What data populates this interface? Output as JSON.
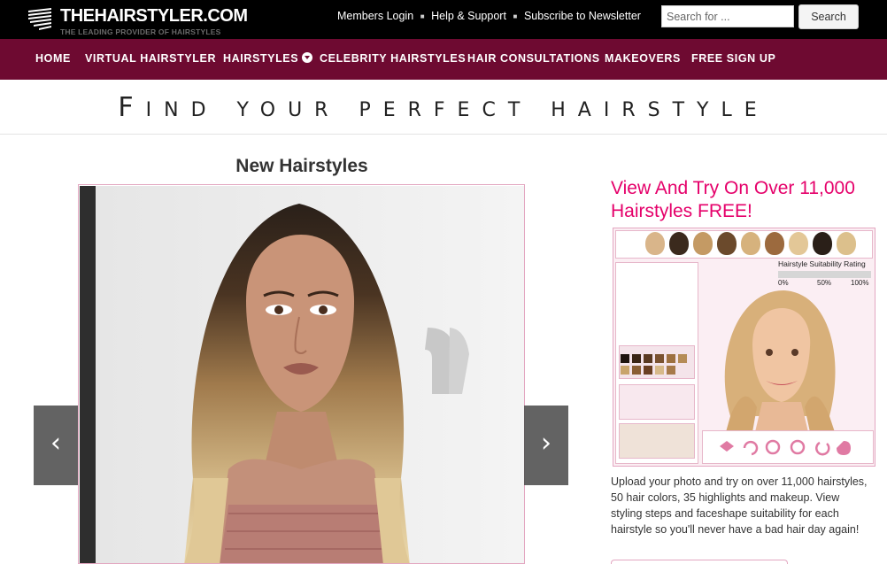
{
  "header": {
    "logo_title": "THEHAIRSTYLER.COM",
    "logo_tagline": "THE LEADING PROVIDER OF HAIRSTYLES",
    "top_links": [
      "Members Login",
      "Help & Support",
      "Subscribe to Newsletter"
    ],
    "search": {
      "placeholder": "Search for ...",
      "button_label": "Search"
    }
  },
  "nav": {
    "items": [
      "HOME",
      "VIRTUAL HAIRSTYLER",
      "HAIRSTYLES",
      "CELEBRITY HAIRSTYLES",
      "HAIR CONSULTATIONS",
      "MAKEOVERS",
      "FREE SIGN UP"
    ]
  },
  "headline": {
    "first_letter": "F",
    "rest": "ind your perfect hairstyle"
  },
  "slider": {
    "title": "New Hairstyles",
    "prev_icon": "chevron-left-icon",
    "next_icon": "chevron-right-icon"
  },
  "promo": {
    "title": "View And Try On Over 11,000 Hairstyles FREE!",
    "body": "Upload your photo and try on over 11,000 hairstyles, 50 hair colors, 35 highlights and makeup. View styling steps and faceshape suitability for each hairstyle so you'll never have a bad hair day again!",
    "app": {
      "suitability_label": "Hairstyle Suitability Rating",
      "scale": [
        "0%",
        "50%",
        "100%"
      ]
    }
  },
  "colors": {
    "topbar": "#000000",
    "navbar": "#6e0a31",
    "accent": "#e5006a",
    "frame": "#e3a7c1"
  }
}
